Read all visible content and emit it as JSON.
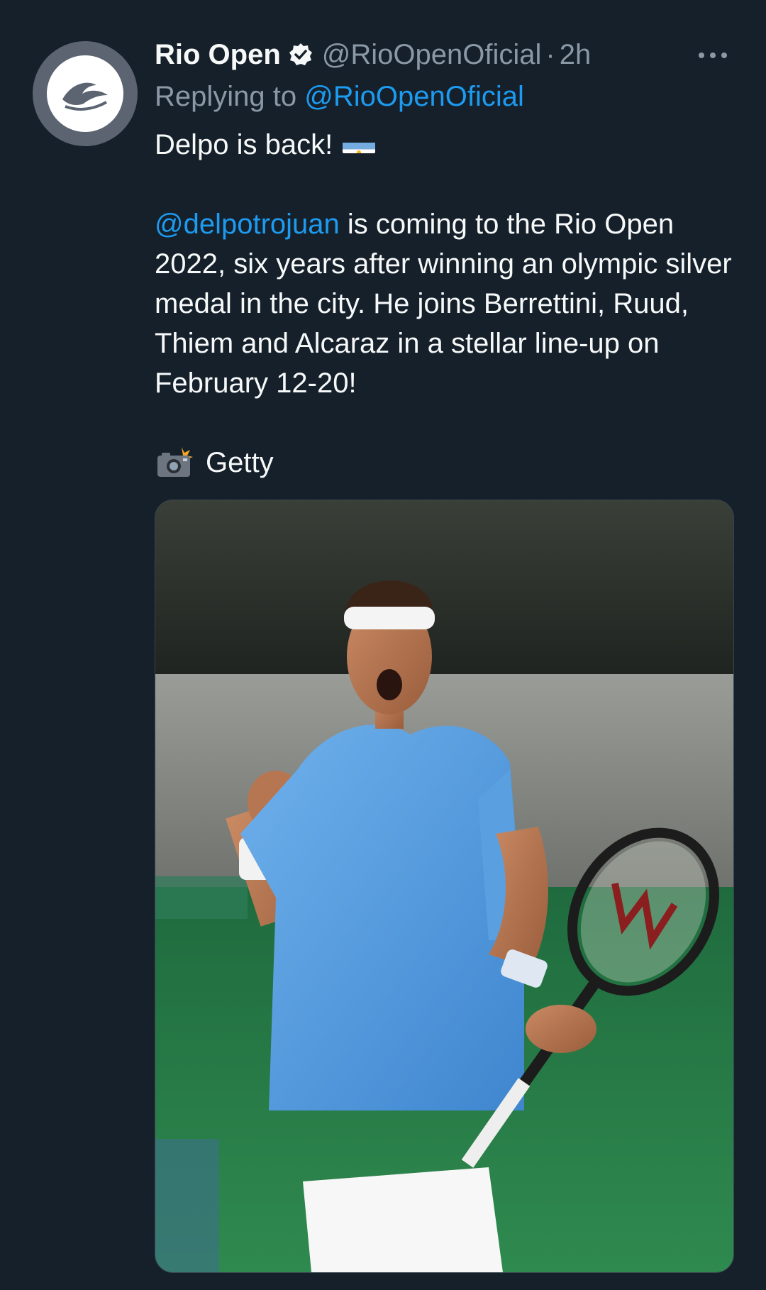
{
  "tweet": {
    "author_name": "Rio Open",
    "handle": "@RioOpenOficial",
    "separator": "·",
    "time": "2h",
    "replying_prefix": "Replying to",
    "replying_to": "@RioOpenOficial",
    "line1": "Delpo is back!",
    "mention": "@delpotrojuan",
    "body_text": " is coming to the Rio Open 2022, six years after winning an olympic silver medal in the city. He joins Berrettini, Ruud, Thiem and Alcaraz in a stellar line-up on February 12-20!",
    "photo_credit": "Getty",
    "icons": {
      "avatar": "rio-open-logo",
      "verified": "verified-badge-icon",
      "more": "more-options-icon",
      "flag": "argentina-flag-emoji",
      "camera": "camera-flash-emoji"
    },
    "colors": {
      "background": "#15202b",
      "link": "#1d9bf0",
      "secondary_text": "#8b98a5"
    }
  }
}
